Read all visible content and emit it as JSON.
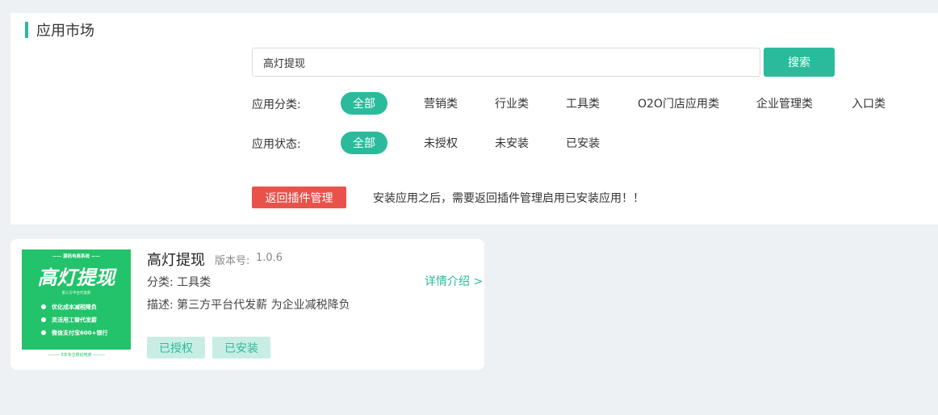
{
  "page": {
    "title": "应用市场"
  },
  "search": {
    "value": "高灯提现",
    "button_label": "搜索"
  },
  "filters": {
    "category": {
      "label": "应用分类:",
      "options": [
        "全部",
        "营销类",
        "行业类",
        "工具类",
        "O2O门店应用类",
        "企业管理类",
        "入口类"
      ],
      "selected": "全部"
    },
    "status": {
      "label": "应用状态:",
      "options": [
        "全部",
        "未授权",
        "未安装",
        "已安装"
      ],
      "selected": "全部"
    }
  },
  "actions": {
    "back_label": "返回插件管理",
    "notice": "安装应用之后，需要返回插件管理启用已安装应用！！"
  },
  "apps": [
    {
      "name": "高灯提现",
      "version_label": "版本号:",
      "version": "1.0.6",
      "category_text": "分类: 工具类",
      "description_text": "描述: 第三方平台代发薪 为企业减税降负",
      "detail_link": "详情介绍 >",
      "tags": [
        "已授权",
        "已安装"
      ],
      "thumbnail": {
        "top_banner": "—— 源码电商系统 ——",
        "headline": "高灯提现",
        "subhead": "第三方平台代发薪",
        "bullets": [
          "优化成本减税降负",
          "灵活用工替代发薪",
          "微信支付宝600+银行"
        ],
        "footer": "——— 5年专注移动电商 ———",
        "bg_color": "#22c36a"
      }
    }
  ],
  "colors": {
    "accent": "#2bbb9c",
    "danger": "#e9524b",
    "tag_bg": "#c8eee4"
  }
}
